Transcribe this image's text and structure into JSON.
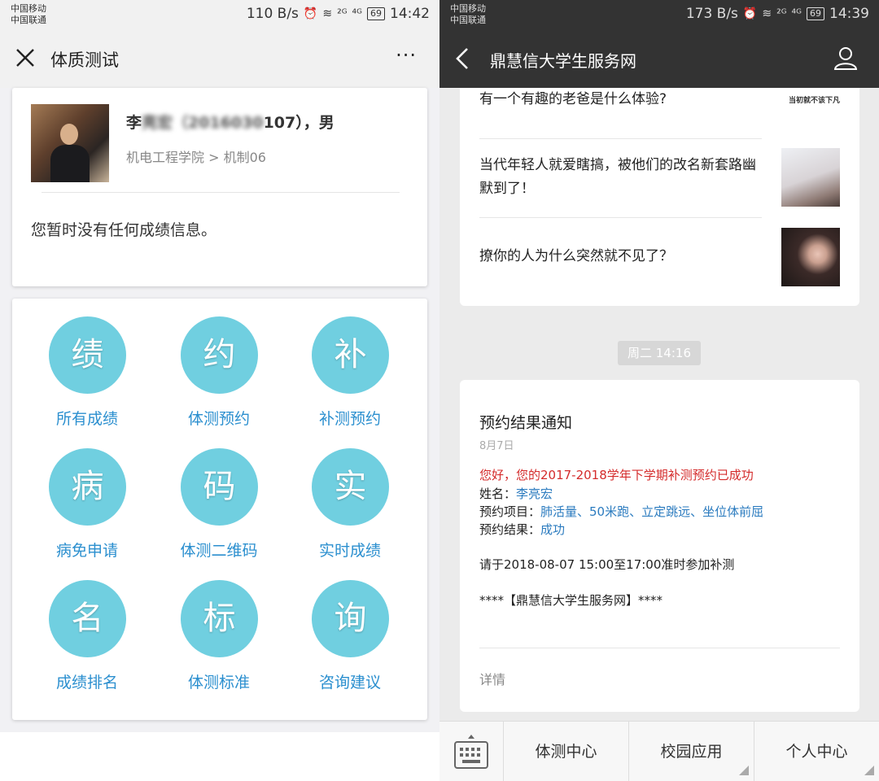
{
  "left_status": {
    "carrier1": "中国移动",
    "carrier2": "中国联通",
    "speed": "110 B/s",
    "net1": "²ᴳ",
    "net2": "⁴ᴳ",
    "battery": "69",
    "time": "14:42"
  },
  "left_header": {
    "title": "体质测试",
    "more": "···"
  },
  "profile": {
    "name_prefix": "李",
    "name_hidden": "亮宏（2016030",
    "name_suffix": "107），男",
    "department": "机电工程学院 > 机制06",
    "no_grades": "您暂时没有任何成绩信息。"
  },
  "menu": [
    {
      "glyph": "绩",
      "label": "所有成绩"
    },
    {
      "glyph": "约",
      "label": "体测预约"
    },
    {
      "glyph": "补",
      "label": "补测预约"
    },
    {
      "glyph": "病",
      "label": "病免申请"
    },
    {
      "glyph": "码",
      "label": "体测二维码"
    },
    {
      "glyph": "实",
      "label": "实时成绩"
    },
    {
      "glyph": "名",
      "label": "成绩排名"
    },
    {
      "glyph": "标",
      "label": "体测标准"
    },
    {
      "glyph": "询",
      "label": "咨询建议"
    }
  ],
  "right_status": {
    "carrier1": "中国移动",
    "carrier2": "中国联通",
    "speed": "173 B/s",
    "net1": "²ᴳ",
    "net2": "⁴ᴳ",
    "battery": "69",
    "time": "14:39"
  },
  "right_header": {
    "title": "鼎慧信大学生服务网"
  },
  "news": [
    {
      "text": "有一个有趣的老爸是什么体验?",
      "thumb_caption": "当初就不该下凡"
    },
    {
      "text": "当代年轻人就爱瞎搞，被他们的改名新套路幽默到了！"
    },
    {
      "text": "撩你的人为什么突然就不见了？"
    }
  ],
  "time_badge": "周二 14:16",
  "notification": {
    "title": "预约结果通知",
    "date": "8月7日",
    "greeting": "您好，您的2017-2018学年下学期补测预约已成功",
    "name_label": "姓名：",
    "name_value": "李亮宏",
    "items_label": "预约项目：",
    "items_value": "肺活量、50米跑、立定跳远、坐位体前屈",
    "result_label": "预约结果：",
    "result_value": "成功",
    "instruction": "请于2018-08-07 15:00至17:00准时参加补测",
    "signature": "****【鼎慧信大学生服务网】****",
    "detail": "详情"
  },
  "bottom_nav": [
    {
      "label": "体测中心"
    },
    {
      "label": "校园应用"
    },
    {
      "label": "个人中心"
    }
  ],
  "colors": {
    "accent_blue": "#2b8fcf",
    "circle": "#70cfe0",
    "alert_red": "#d42b2b",
    "dark_header": "#333333"
  }
}
